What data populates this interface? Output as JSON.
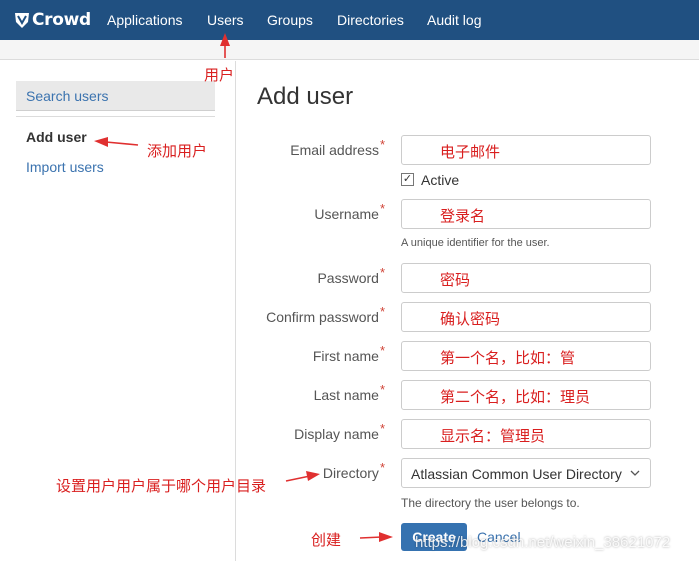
{
  "app": {
    "brand": "Crowd",
    "nav": [
      "Applications",
      "Users",
      "Groups",
      "Directories",
      "Audit log"
    ]
  },
  "sidebar": {
    "search": "Search users",
    "add": "Add user",
    "import": "Import users"
  },
  "form": {
    "title": "Add user",
    "required_mark": "*",
    "email": {
      "label": "Email address",
      "value": "电子邮件"
    },
    "active": {
      "label": "Active",
      "checked": true
    },
    "username": {
      "label": "Username",
      "value": "登录名",
      "hint": "A unique identifier for the user."
    },
    "password": {
      "label": "Password",
      "value": "密码"
    },
    "confirm": {
      "label": "Confirm password",
      "value": "确认密码"
    },
    "first_name": {
      "label": "First name",
      "value": "第一个名，比如：管"
    },
    "last_name": {
      "label": "Last name",
      "value": "第二个名，比如：理员"
    },
    "display_name": {
      "label": "Display name",
      "value": "显示名：管理员"
    },
    "directory": {
      "label": "Directory",
      "value": "Atlassian Common User Directory",
      "hint": "The directory the user belongs to."
    },
    "create": "Create",
    "cancel": "Cancel"
  },
  "annotations": {
    "users": "用户",
    "add_user": "添加用户",
    "directory": "设置用户用户属于哪个用户目录",
    "create": "创建"
  },
  "watermark": "https://blog.csdn.net/weixin_38621072",
  "colors": {
    "nav": "#205081",
    "link": "#3b73af",
    "button": "#3572b0",
    "annotation": "#d91f1f"
  }
}
